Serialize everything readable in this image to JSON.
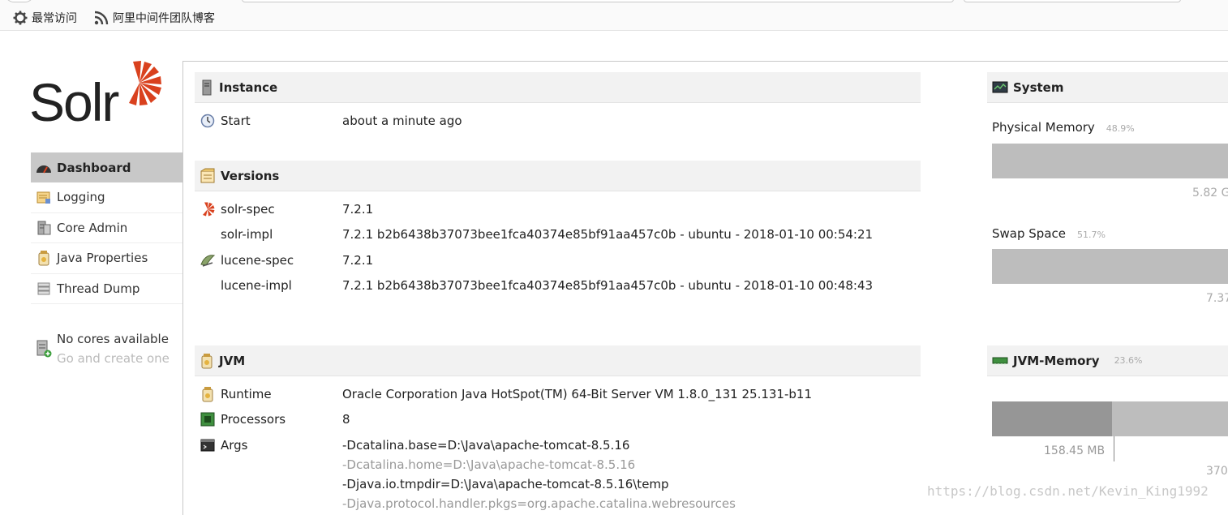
{
  "bookmarks": [
    {
      "label": "最常访问",
      "icon": "gear-icon"
    },
    {
      "label": "阿里中间件团队博客",
      "icon": "rss-icon"
    }
  ],
  "logo": {
    "text": "Solr",
    "accent": "#d9411e"
  },
  "nav": {
    "items": [
      {
        "label": "Dashboard",
        "icon": "dashboard-icon",
        "active": true
      },
      {
        "label": "Logging",
        "icon": "logging-icon"
      },
      {
        "label": "Core Admin",
        "icon": "core-admin-icon"
      },
      {
        "label": "Java Properties",
        "icon": "java-properties-icon"
      },
      {
        "label": "Thread Dump",
        "icon": "thread-dump-icon"
      }
    ],
    "no_cores": {
      "title": "No cores available",
      "link": "Go and create one"
    }
  },
  "instance": {
    "title": "Instance",
    "start_label": "Start",
    "start_value": "about a minute ago"
  },
  "versions": {
    "title": "Versions",
    "rows": [
      {
        "label": "solr-spec",
        "value": "7.2.1"
      },
      {
        "label": "solr-impl",
        "value": "7.2.1 b2b6438b37073bee1fca40374e85bf91aa457c0b - ubuntu - 2018-01-10 00:54:21"
      },
      {
        "label": "lucene-spec",
        "value": "7.2.1"
      },
      {
        "label": "lucene-impl",
        "value": "7.2.1 b2b6438b37073bee1fca40374e85bf91aa457c0b - ubuntu - 2018-01-10 00:48:43"
      }
    ]
  },
  "jvm": {
    "title": "JVM",
    "runtime_label": "Runtime",
    "runtime_value": "Oracle Corporation Java HotSpot(TM) 64-Bit Server VM 1.8.0_131 25.131-b11",
    "processors_label": "Processors",
    "processors_value": "8",
    "args_label": "Args",
    "args": [
      "-Dcatalina.base=D:\\Java\\apache-tomcat-8.5.16",
      "-Dcatalina.home=D:\\Java\\apache-tomcat-8.5.16",
      "-Djava.io.tmpdir=D:\\Java\\apache-tomcat-8.5.16\\temp",
      "-Djava.protocol.handler.pkgs=org.apache.catalina.webresources"
    ]
  },
  "system": {
    "title": "System",
    "physical_memory": {
      "label": "Physical Memory",
      "percent": "48.9%",
      "caption": "5.82 G"
    },
    "swap_space": {
      "label": "Swap Space",
      "percent": "51.7%",
      "caption": "7.37"
    },
    "jvm_memory": {
      "label": "JVM-Memory",
      "percent": "23.6%",
      "used": "158.45 MB",
      "caption": "370",
      "used_fraction": 0.51
    }
  },
  "watermark": "https://blog.csdn.net/Kevin_King1992"
}
